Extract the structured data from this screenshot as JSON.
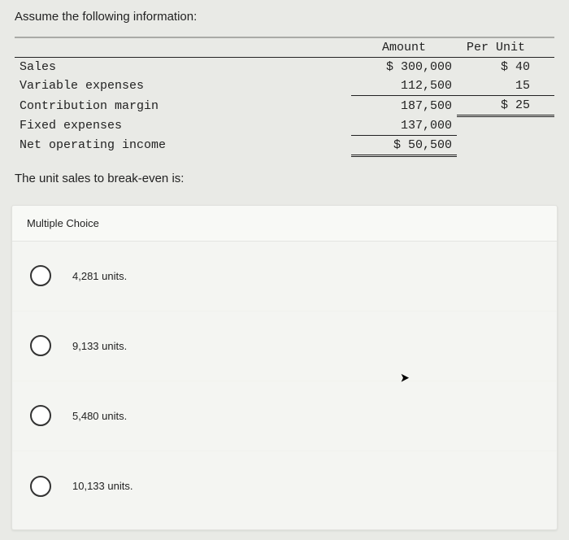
{
  "prompt": "Assume the following information:",
  "table": {
    "headers": {
      "amount": "Amount",
      "per_unit": "Per Unit"
    },
    "rows": {
      "sales": {
        "label": "Sales",
        "amount": "$ 300,000",
        "per_unit": "$ 40"
      },
      "varexp": {
        "label": "Variable expenses",
        "amount": "112,500",
        "per_unit": "15"
      },
      "cm": {
        "label": "Contribution margin",
        "amount": "187,500",
        "per_unit": "$ 25"
      },
      "fixedexp": {
        "label": "Fixed expenses",
        "amount": "137,000",
        "per_unit": ""
      },
      "noi": {
        "label": "Net operating income",
        "amount": "$ 50,500",
        "per_unit": ""
      }
    }
  },
  "question": "The unit sales to break-even is:",
  "mc_header": "Multiple Choice",
  "options": [
    {
      "label": "4,281 units."
    },
    {
      "label": "9,133 units."
    },
    {
      "label": "5,480 units."
    },
    {
      "label": "10,133 units."
    }
  ]
}
